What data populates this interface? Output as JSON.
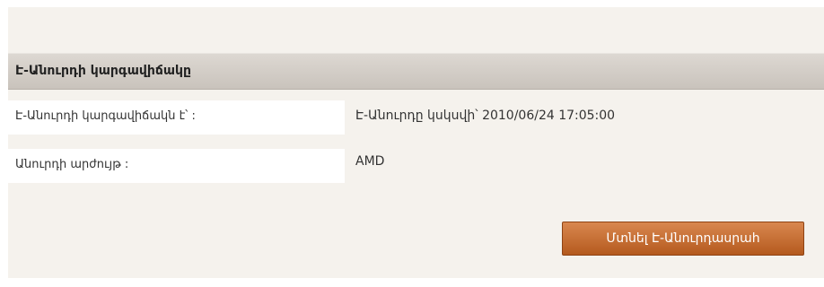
{
  "section": {
    "title": "Է-Անուրդի կարգավիճակը"
  },
  "rows": [
    {
      "label": "Է-Անուրդի կարգավիճակն է՝ :",
      "value": "Է-Անուրդը կսկսվի՝ 2010/06/24 17:05:00"
    },
    {
      "label": "Անուրդի արժույթ :",
      "value": "AMD"
    }
  ],
  "actions": {
    "enter_label": "Մտնել Է-Անուրդասրահ"
  },
  "colors": {
    "panel_bg": "#f5f2ed",
    "header_bg": "#d3cdc6",
    "button_bg": "#c4692c"
  }
}
